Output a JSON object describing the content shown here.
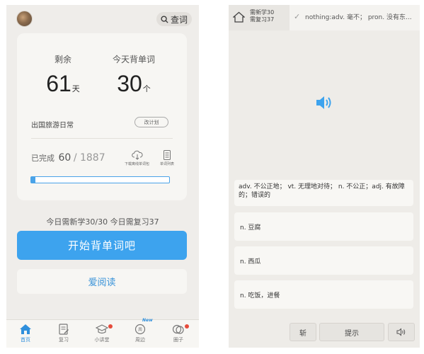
{
  "left": {
    "search_label": "查词",
    "stats": {
      "remaining_label": "剩余",
      "remaining_value": "61",
      "remaining_unit": "天",
      "today_label": "今天背单词",
      "today_value": "30",
      "today_unit": "个"
    },
    "plan_name": "出国旅游日常",
    "change_plan_label": "改计划",
    "completed_label": "已完成",
    "completed_value": "60",
    "total_value": "/ 1887",
    "progress": 0.032,
    "download_label": "下载离线单词包",
    "wordlist_label": "单词列表",
    "today_summary": "今日需新学30/30  今日需复习37",
    "start_button": "开始背单词吧",
    "read_button": "爱阅读",
    "tabs": [
      {
        "label": "首页",
        "icon": "home-icon",
        "active": true
      },
      {
        "label": "复习",
        "icon": "review-icon",
        "active": false
      },
      {
        "label": "小讲堂",
        "icon": "classroom-icon",
        "active": false
      },
      {
        "label": "周边",
        "icon": "nearby-icon",
        "active": false
      },
      {
        "label": "圈子",
        "icon": "circle-icon",
        "active": false
      }
    ],
    "new_badge": "New"
  },
  "right": {
    "new_count_label": "需新学30",
    "review_count_label": "需复习37",
    "recent_text": "nothing:adv. 毫不；   pron. 没有东...",
    "meanings": [
      "adv. 不公正地；  vt. 无理地对待；  n. 不公正；adj. 有故障的；错误的",
      "n. 豆腐",
      "n. 西瓜",
      "n. 吃饭，进餐"
    ],
    "bottom_buttons": {
      "new": "斩",
      "hint": "提示"
    }
  },
  "colors": {
    "accent_blue": "#3da3ee",
    "badge_red": "#e54b3b"
  }
}
